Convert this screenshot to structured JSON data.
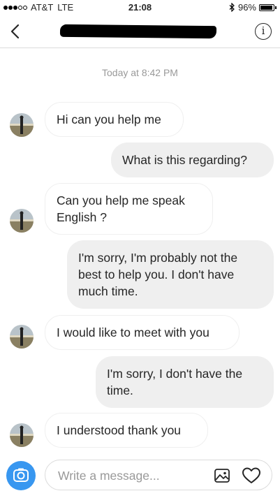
{
  "status_bar": {
    "carrier": "AT&T",
    "network": "LTE",
    "time": "21:08",
    "battery": "96%",
    "battery_level": 0.96
  },
  "header": {
    "back_icon": "chevron-left-icon",
    "info_icon": "info-icon"
  },
  "conversation": {
    "timestamp": "Today at 8:42 PM",
    "messages": [
      {
        "from": "them",
        "text": "Hi can you help me"
      },
      {
        "from": "me",
        "text": "What is this regarding?"
      },
      {
        "from": "them",
        "text": "Can you help me speak\nEnglish ?"
      },
      {
        "from": "me",
        "text": "I'm sorry, I'm probably not the\nbest to help you. I don't have\nmuch time."
      },
      {
        "from": "them",
        "text": "I would like to meet with you"
      },
      {
        "from": "me",
        "text": "I'm sorry, I don't have the\ntime."
      },
      {
        "from": "them",
        "text": "I understood thank you"
      }
    ]
  },
  "composer": {
    "placeholder": "Write a message...",
    "camera_icon": "camera-icon",
    "gallery_icon": "gallery-icon",
    "heart_icon": "heart-icon"
  },
  "colors": {
    "accent": "#3897f0",
    "outgoing_bubble": "#efefef",
    "incoming_border": "#efefef"
  }
}
